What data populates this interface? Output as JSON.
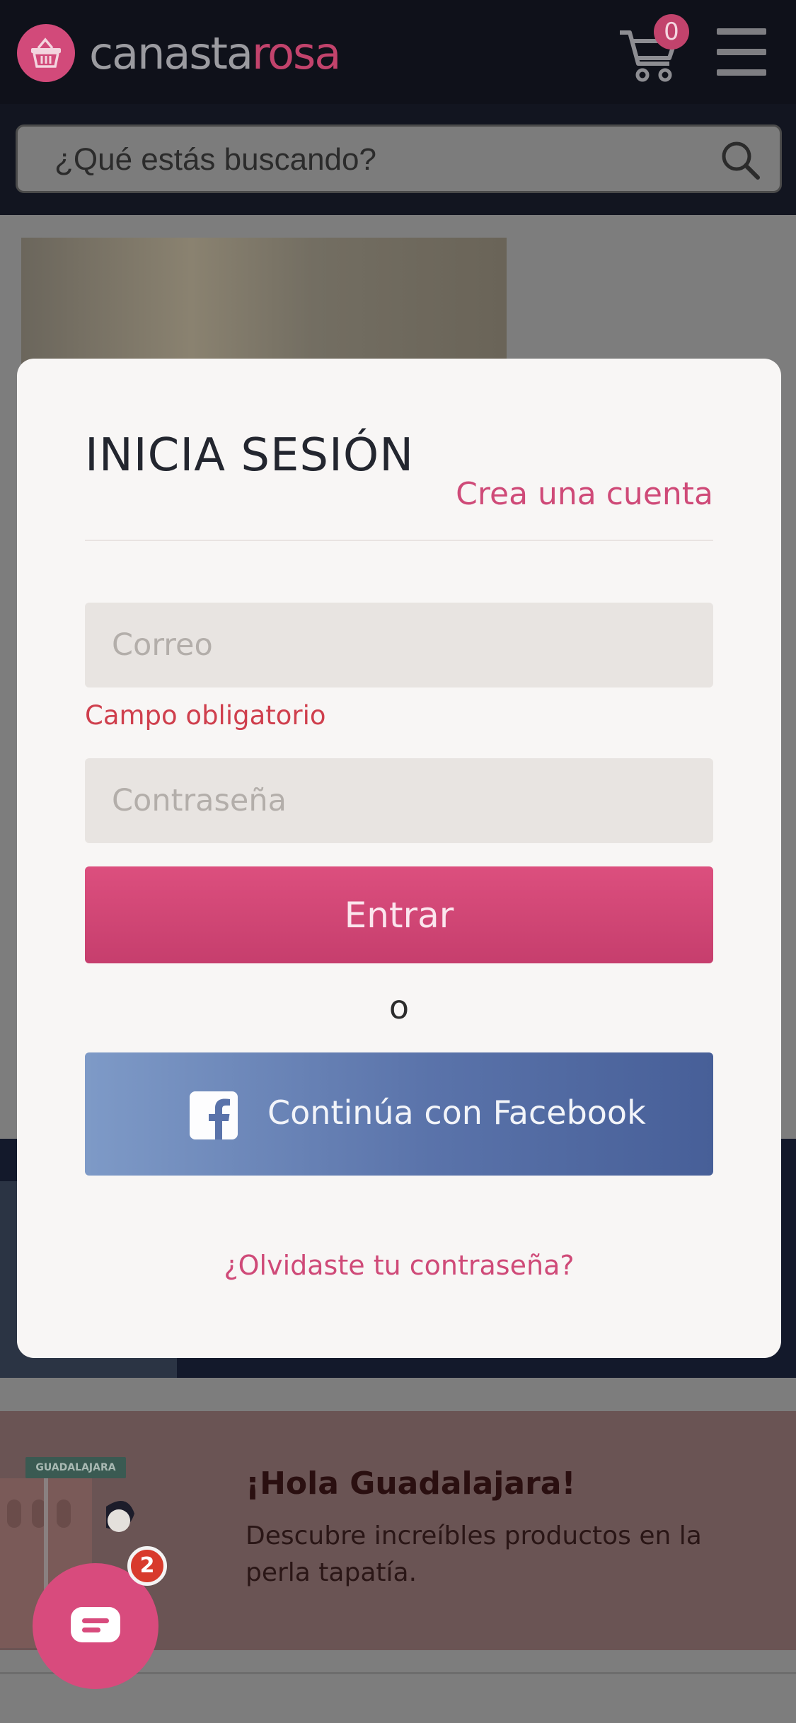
{
  "header": {
    "logo_part1": "canasta",
    "logo_part2": "rosa",
    "cart_count": "0",
    "search_placeholder": "¿Qué estás buscando?"
  },
  "login": {
    "title": "INICIA SESIÓN",
    "create_account": "Crea una cuenta",
    "email_placeholder": "Correo",
    "email_error": "Campo obligatorio",
    "password_placeholder": "Contraseña",
    "submit": "Entrar",
    "or": "o",
    "facebook": "Continúa con Facebook",
    "forgot": "¿Olvidaste tu contraseña?"
  },
  "promo": {
    "sign": "GUADALAJARA",
    "title": "¡Hola Guadalajara!",
    "description": "Descubre increíbles productos en la perla tapatía."
  },
  "chat": {
    "badge": "2"
  },
  "colors": {
    "brand_pink": "#cf4a78",
    "facebook_blue": "#5a73aa",
    "error_red": "#cf3f4d"
  },
  "icons": [
    "basket-logo-icon",
    "cart-icon",
    "hamburger-menu-icon",
    "search-icon",
    "facebook-icon",
    "chat-icon"
  ]
}
